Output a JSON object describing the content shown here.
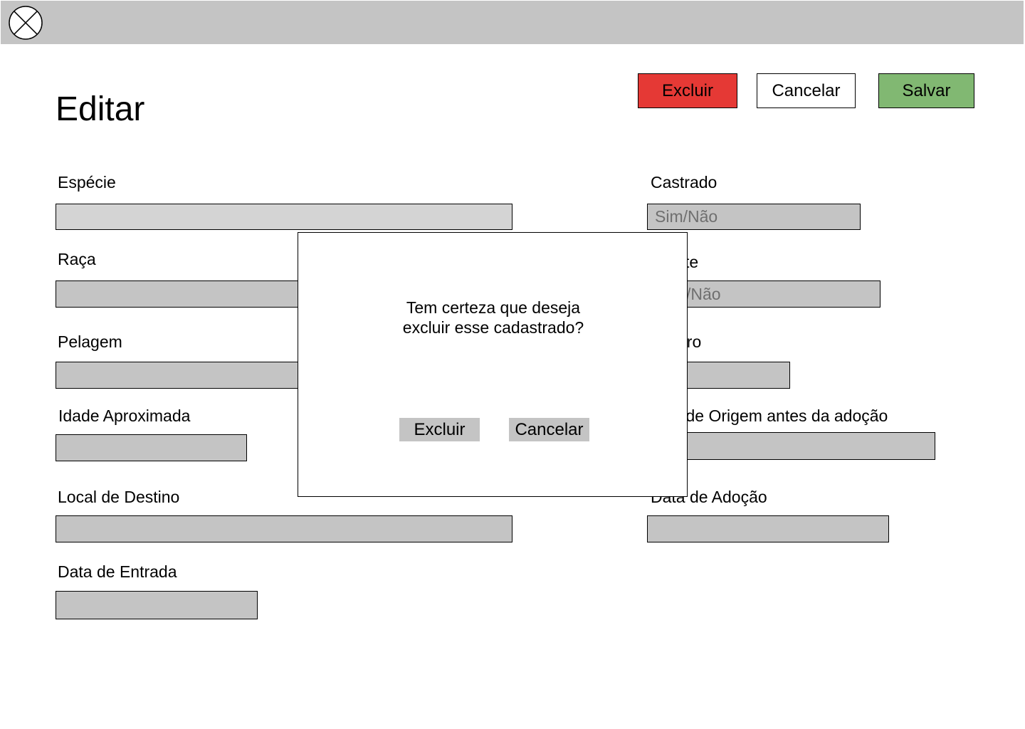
{
  "header": {
    "logo_icon": "close-circle-icon"
  },
  "page": {
    "title": "Editar"
  },
  "actions": {
    "delete_label": "Excluir",
    "cancel_label": "Cancelar",
    "save_label": "Salvar"
  },
  "colors": {
    "delete": "#e53935",
    "save": "#81b872",
    "field": "#c4c4c4"
  },
  "form": {
    "especie": {
      "label": "Espécie",
      "value": ""
    },
    "raca": {
      "label": "Raça",
      "value": ""
    },
    "pelagem": {
      "label": "Pelagem",
      "value": ""
    },
    "idade": {
      "label": "Idade Aproximada",
      "value": ""
    },
    "local_destino": {
      "label": "Local de Destino",
      "value": ""
    },
    "data_entrada": {
      "label": "Data de Entrada",
      "value": ""
    },
    "castrado": {
      "label": "Castrado",
      "placeholder": "Sim/Não"
    },
    "vacinado": {
      "label": "te",
      "placeholder": "/Não"
    },
    "genero": {
      "label": "ero",
      "value": ""
    },
    "local_origem": {
      "label": "l de Origem antes da adoção",
      "value": ""
    },
    "data_adocao": {
      "label": "Data de Adoção",
      "value": ""
    }
  },
  "modal": {
    "message": "Tem certeza que deseja\nexcluir esse cadastrado?",
    "confirm_label": "Excluir",
    "cancel_label": "Cancelar"
  }
}
